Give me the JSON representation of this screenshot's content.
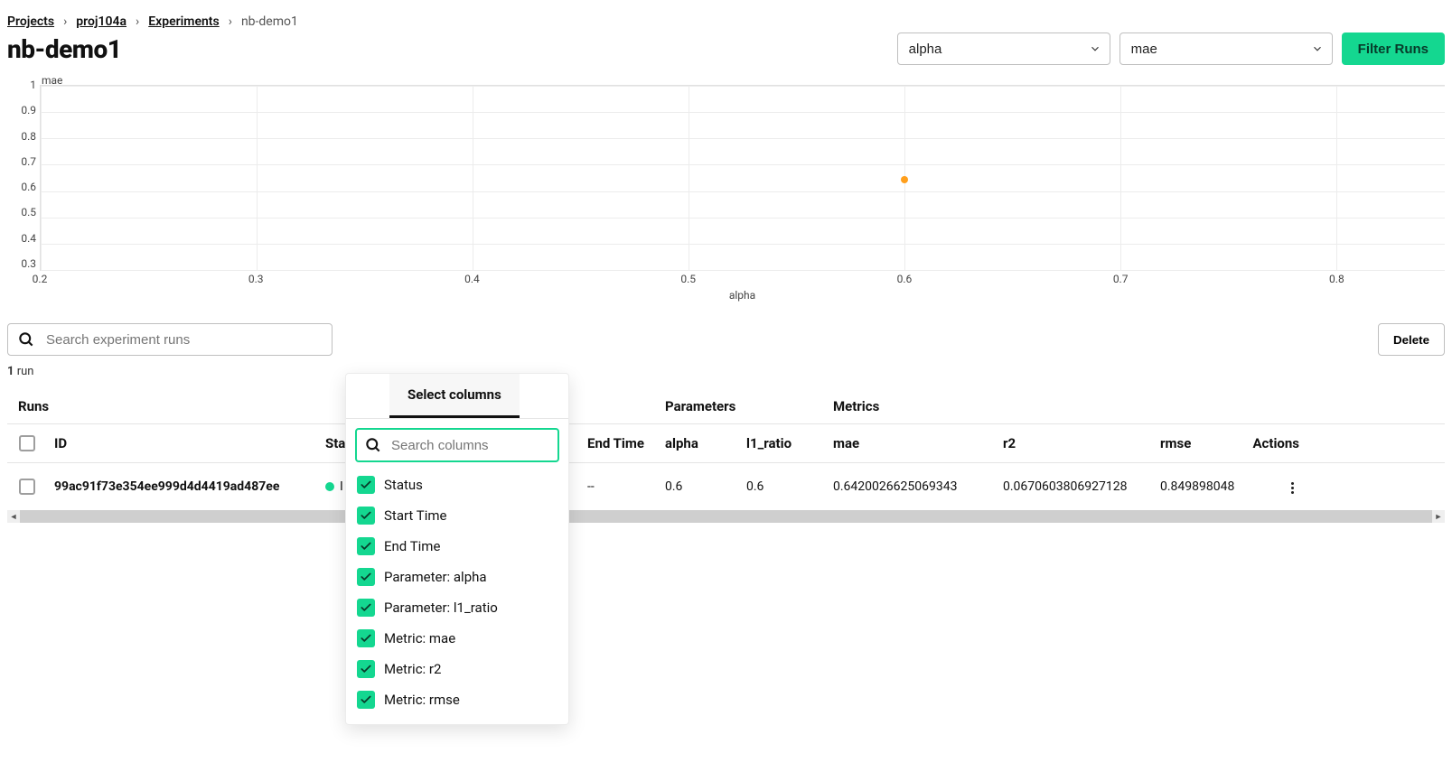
{
  "breadcrumb": {
    "projects": "Projects",
    "project": "proj104a",
    "experiments": "Experiments",
    "current": "nb-demo1"
  },
  "page_title": "nb-demo1",
  "controls": {
    "x_param": "alpha",
    "y_metric": "mae",
    "filter_button": "Filter Runs"
  },
  "chart_data": {
    "type": "scatter",
    "title": "",
    "xlabel": "alpha",
    "ylabel": "mae",
    "xlim": [
      0.2,
      0.85
    ],
    "ylim": [
      0.3,
      1.0
    ],
    "xticks": [
      0.2,
      0.3,
      0.4,
      0.5,
      0.6,
      0.7,
      0.8
    ],
    "yticks": [
      0.3,
      0.4,
      0.5,
      0.6,
      0.7,
      0.8,
      0.9,
      1.0
    ],
    "series": [
      {
        "name": "runs",
        "x": [
          0.6
        ],
        "y": [
          0.642
        ],
        "color": "#ff9f1c"
      }
    ]
  },
  "search": {
    "placeholder": "Search experiment runs"
  },
  "run_count": {
    "count": "1",
    "label": "run"
  },
  "delete_button": "Delete",
  "table": {
    "group_headers": {
      "runs": "Runs",
      "parameters": "Parameters",
      "metrics": "Metrics"
    },
    "columns": {
      "id": "ID",
      "status": "Sta",
      "end_time": "End Time",
      "alpha": "alpha",
      "l1_ratio": "l1_ratio",
      "mae": "mae",
      "r2": "r2",
      "rmse": "rmse",
      "actions": "Actions"
    },
    "rows": [
      {
        "id": "99ac91f73e354ee999d4d4419ad487ee",
        "status_text": "I",
        "end_time": "--",
        "alpha": "0.6",
        "l1_ratio": "0.6",
        "mae": "0.6420026625069343",
        "r2": "0.0670603806927128",
        "rmse": "0.849898048"
      }
    ]
  },
  "popover": {
    "tab_label": "Select columns",
    "search_placeholder": "Search columns",
    "items": [
      {
        "label": "Status",
        "checked": true
      },
      {
        "label": "Start Time",
        "checked": true
      },
      {
        "label": "End Time",
        "checked": true
      },
      {
        "label": "Parameter: alpha",
        "checked": true
      },
      {
        "label": "Parameter: l1_ratio",
        "checked": true
      },
      {
        "label": "Metric: mae",
        "checked": true
      },
      {
        "label": "Metric: r2",
        "checked": true
      },
      {
        "label": "Metric: rmse",
        "checked": true
      }
    ]
  }
}
